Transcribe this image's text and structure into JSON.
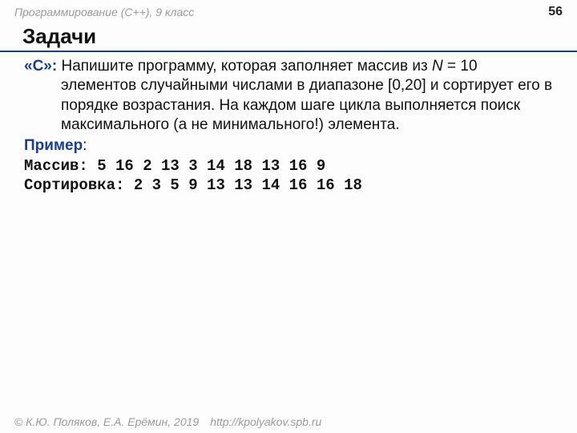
{
  "header": {
    "course": "Программирование (C++), 9 класс",
    "page": "56"
  },
  "title": "Задачи",
  "task": {
    "label": "«C»:",
    "text_part1": " Напишите программу, которая заполняет массив из ",
    "n": "N",
    "text_part2": " = 10 элементов случайными числами в диапазоне [0,20] и сортирует его в порядке возрастания. На каждом шаге цикла выполняется поиск максимального (а не минимального!) элемента."
  },
  "example": {
    "label": "Пример",
    "colon": ":",
    "array_label": "Массив: ",
    "array_values": "5 16 2 13 3 14 18 13 16 9",
    "sort_label": "Сортировка: ",
    "sort_values": "2 3 5 9 13 13 14 16 16 18"
  },
  "footer": {
    "copyright": "© К.Ю. Поляков, Е.А. Ерёмин, 2019",
    "url": "http://kpolyakov.spb.ru"
  }
}
